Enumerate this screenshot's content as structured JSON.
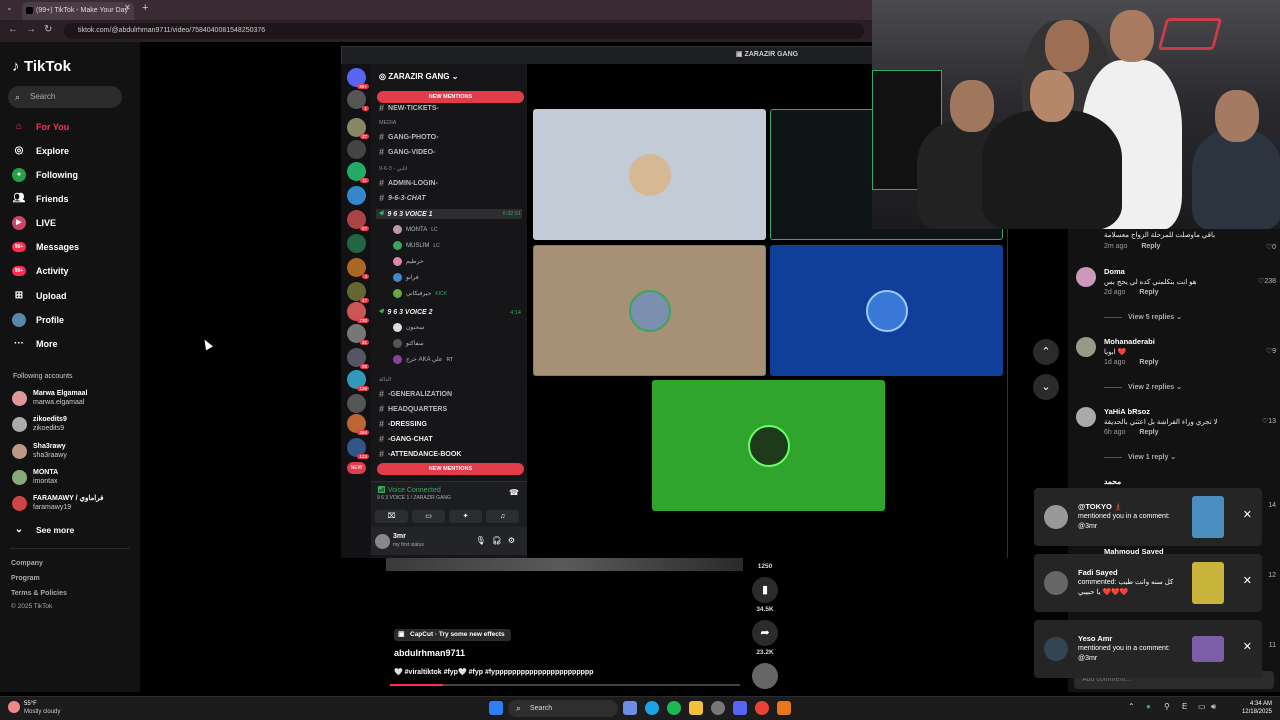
{
  "browser": {
    "tab_title": "(99+) TikTok - Make Your Day",
    "url": "tiktok.com/@abdulrhman9711/video/7584040081548250376"
  },
  "sidebar": {
    "logo": "TikTok",
    "search_placeholder": "Search",
    "nav": [
      {
        "label": "For You",
        "icon": "home-icon"
      },
      {
        "label": "Explore",
        "icon": "compass-icon"
      },
      {
        "label": "Following",
        "icon": "following-icon"
      },
      {
        "label": "Friends",
        "icon": "friends-icon"
      },
      {
        "label": "LIVE",
        "icon": "live-icon"
      },
      {
        "label": "Messages",
        "icon": "messages-icon",
        "badge": "99+"
      },
      {
        "label": "Activity",
        "icon": "activity-icon",
        "badge": "99+"
      },
      {
        "label": "Upload",
        "icon": "upload-icon"
      },
      {
        "label": "Profile",
        "icon": "profile-icon"
      },
      {
        "label": "More",
        "icon": "more-icon"
      }
    ],
    "following_header": "Following accounts",
    "accounts": [
      {
        "name": "Marwa Elgamaal",
        "handle": "marwa.elgamaal"
      },
      {
        "name": "zikoedits9",
        "handle": "zikoedits9"
      },
      {
        "name": "Sha3rawy",
        "handle": "sha3raawy"
      },
      {
        "name": "MONTA",
        "handle": "imontax"
      },
      {
        "name": "FARAMAWY / فراماوي",
        "handle": "faramawy19"
      }
    ],
    "see_more": "See more",
    "footer": [
      "Company",
      "Program",
      "Terms & Policies"
    ],
    "copyright": "© 2025 TikTok"
  },
  "discord": {
    "guild": "ZARAZIR GANG",
    "stage_title": "ZARAZIR GANG",
    "new_mentions": "NEW MENTIONS",
    "channels": [
      {
        "label": "NEW-TICKETS-",
        "kind": "text"
      },
      {
        "label": "MEDIA",
        "kind": "category"
      },
      {
        "label": "GANG-PHOTO-",
        "kind": "text"
      },
      {
        "label": "GANG-VIDEO-",
        "kind": "text"
      },
      {
        "label": "9-6-3 - انابي",
        "kind": "category"
      },
      {
        "label": "ADMIN-LOGIN-",
        "kind": "text"
      },
      {
        "label": "9-6-3-CHAT",
        "kind": "text"
      },
      {
        "label": "9 6 3 VOICE 1",
        "kind": "voice",
        "right": "6:32:01"
      },
      {
        "label": "MONTA",
        "kind": "user",
        "tag": "LC"
      },
      {
        "label": "MUSLIM",
        "kind": "user",
        "tag": "LC"
      },
      {
        "label": "خرطيم",
        "kind": "user"
      },
      {
        "label": "فرانو",
        "kind": "user"
      },
      {
        "label": "جيرفيكاني",
        "kind": "user",
        "tag": "KICK"
      },
      {
        "label": "9 6 3 VOICE 2",
        "kind": "voice",
        "right": "4:14"
      },
      {
        "label": "سحنون",
        "kind": "user"
      },
      {
        "label": "سفاكتو",
        "kind": "user"
      },
      {
        "label": "خرج AKA علي",
        "kind": "user",
        "tag": "RT"
      },
      {
        "label": "الدالة",
        "kind": "category"
      },
      {
        "label": "-GENERALIZATION",
        "kind": "text"
      },
      {
        "label": "HEADQUARTERS",
        "kind": "text"
      },
      {
        "label": "-DRESSING",
        "kind": "text"
      },
      {
        "label": "-GANG-CHAT",
        "kind": "text"
      },
      {
        "label": "-ATTENDANCE-BOOK",
        "kind": "text"
      }
    ],
    "voice_status": "Voice Connected",
    "voice_sub": "9 6 3 VOICE 1 / ZARAZIR GANG",
    "user_name": "3mr",
    "user_status": "my first status",
    "server_badges": [
      "99+",
      "1",
      "27",
      "11",
      "27",
      "4",
      "47",
      "730",
      "31",
      "26",
      "136",
      "264",
      "123",
      "NEW"
    ],
    "tiles": [
      {
        "bg": "#c3ccd6",
        "pic": "#d6b894"
      },
      {
        "bg": "#0f1416",
        "pic": ""
      },
      {
        "bg": "#a69176",
        "pic": "#7d8fb0"
      },
      {
        "bg": "#0f3f99",
        "pic": "#3a78d8"
      },
      {
        "bg": "#2fa52b",
        "pic": "#1e3a1a"
      }
    ]
  },
  "comments": [
    {
      "name": "",
      "text": "باقي ماوصلت للمرحلة الزواج معسلامة",
      "time": "2m ago",
      "reply": "Reply",
      "likes": "0"
    },
    {
      "name": "Doma",
      "text": "هو انت بتكلمني كده لي يحج بس",
      "time": "2d ago",
      "reply": "Reply",
      "likes": "238",
      "replies": "View 5 replies"
    },
    {
      "name": "Mohanaderabi",
      "text": "ابويا ❤️",
      "time": "1d ago",
      "reply": "Reply",
      "likes": "9",
      "replies": "View 2 replies"
    },
    {
      "name": "YaHiA bRsoz",
      "text": "لا تجري وراء الفراشة بل اعتني بالحديقة",
      "time": "6h ago",
      "reply": "Reply",
      "likes": "13",
      "replies": "View 1 reply"
    }
  ],
  "comment_tail": {
    "name": "محمد",
    "name2": "Mahmoud Sayed",
    "likes": [
      "14",
      "12",
      "11"
    ]
  },
  "add_comment_placeholder": "Add comment...",
  "video": {
    "author": "abdulrhman9711",
    "desc": "🤍 #viraltiktok #fyp🤍 #fyp #fyppppppppppppppppppppppp",
    "capcut": "CapCut · Try some new effects",
    "counts": {
      "bookmark_pre": "1250",
      "bookmark": "34.5K",
      "share": "23.2K"
    },
    "progress": 0.15
  },
  "notifications": [
    {
      "name": "@TOKYO 🗼",
      "text": "mentioned you in a comment: @3mr",
      "thumb": "#4a8fc0"
    },
    {
      "name": "Fadi Sayed",
      "text": "commented: كل سنه وانت طيب يا حبيبي ❤️❤️❤️",
      "thumb": "#c8b43a"
    },
    {
      "name": "Yeso Amr",
      "text": "mentioned you in a comment: @3mr",
      "thumb": "#7a5fa8"
    }
  ],
  "taskbar": {
    "weather_temp": "55°F",
    "weather_desc": "Mostly cloudy",
    "search": "Search",
    "time": "4:34 AM",
    "date": "12/18/2025"
  }
}
